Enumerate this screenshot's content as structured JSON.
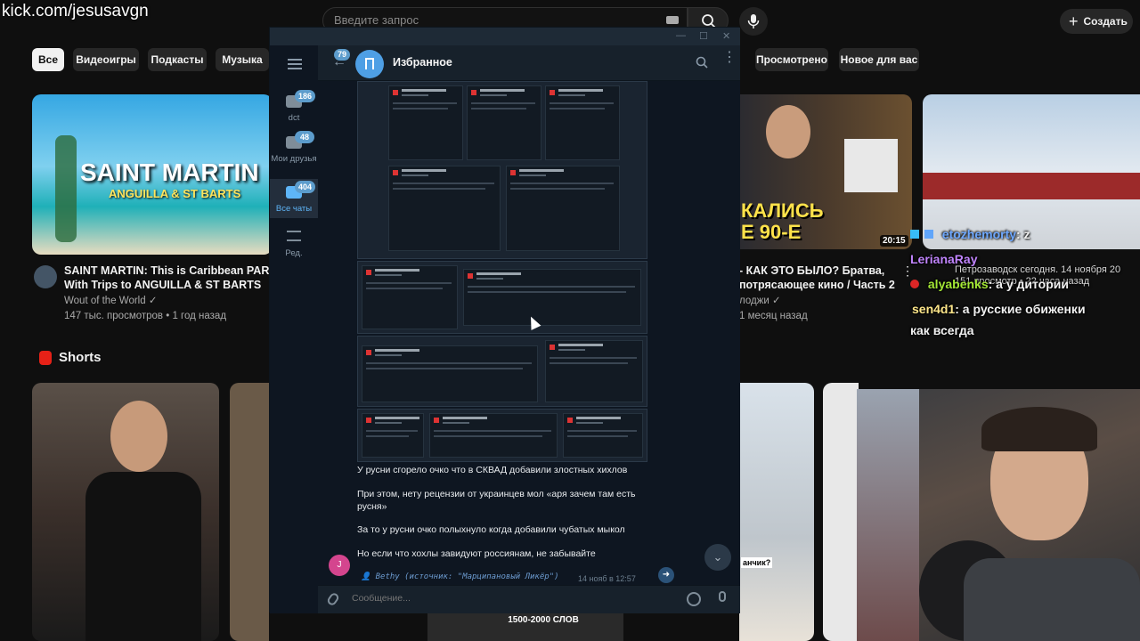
{
  "overlay": {
    "watermark": "kick.com/jesusavgn"
  },
  "youtube": {
    "search_placeholder": "Введите запрос",
    "create_label": "Создать",
    "chips": [
      "Все",
      "Видеоигры",
      "Подкасты",
      "Музыка",
      "Просмотрено",
      "Новое для вас"
    ],
    "videos": [
      {
        "thumb_title": "SAINT MARTIN",
        "thumb_subtitle": "ANGUILLA & ST BARTS",
        "title_line1": "SAINT MARTIN: This is Caribbean PARADIS",
        "title_line2": "With Trips to ANGUILLA & ST BARTS",
        "channel": "Wout of the World",
        "meta": "147 тыс. просмотров • 1 год назад"
      },
      {
        "thumb_text1": "КАЛИСЬ",
        "thumb_text2": "Е 90-Е",
        "duration": "20:15",
        "title_line1": "- КАК ЭТО БЫЛО? Братва,",
        "title_line2": "потрясающее кино / Часть 2",
        "channel": "лоджи",
        "meta": "1 месяц назад"
      },
      {
        "meta": "151 просмотр • 22 часа назад"
      }
    ],
    "shorts_label": "Shorts",
    "short_caption": "1500-2000 СЛОВ",
    "short_text": "анчик?"
  },
  "telegram": {
    "folders": [
      {
        "label": "dct",
        "badge": "186"
      },
      {
        "label": "Мои друзья",
        "badge": "48"
      },
      {
        "label": "Все чаты",
        "badge": "404"
      },
      {
        "label": "Ред.",
        "badge": ""
      }
    ],
    "back_badge": "79",
    "chat_title": "Избранное",
    "messages": [
      "У русни сгорело очко что в СКВАД добавили злостных хихлов",
      "При этом, нету рецензии от украинцев мол «аря зачем там есть русня»",
      "За то у русни очко полыхнуло когда добавили чубатых мыкол",
      "Но если что хохлы завидуют россиянам, не забывайте"
    ],
    "avatar_letter": "J",
    "footer": "👤 Bethy (источник: \"Марципановый Ликёр\")",
    "time": "14 нояб в 12:57",
    "input_placeholder": "Сообщение..."
  },
  "stream_chat": {
    "lines": [
      {
        "user": "etozhemorty",
        "text": ": z",
        "color": "#6ea8ff"
      },
      {
        "user": "LerianaRay",
        "text": "",
        "color": "#c084fc"
      },
      {
        "user": "alyabenks",
        "text": ": а у дитории",
        "color": "#a3e635"
      },
      {
        "user": "sen4d1",
        "text": ": а русские обиженки",
        "color": "#fde68a"
      }
    ],
    "continuation": "как всегда",
    "overlay_meta": "Петрозаводск сегодня. 14 ноября 20"
  }
}
